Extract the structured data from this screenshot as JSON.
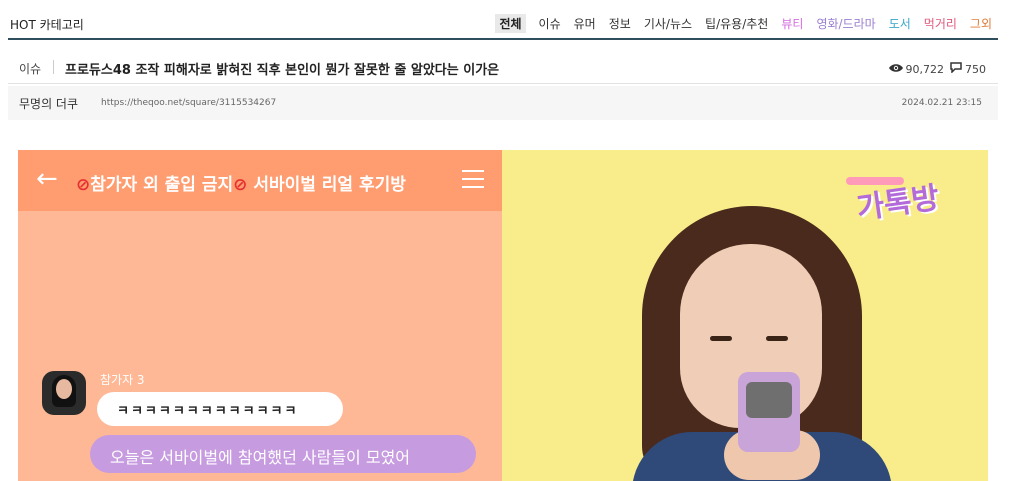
{
  "category_bar": {
    "label": "HOT 카테고리",
    "categories": [
      {
        "label": "전체",
        "color": "#222222",
        "active": true
      },
      {
        "label": "이슈",
        "color": "#333333"
      },
      {
        "label": "유머",
        "color": "#333333"
      },
      {
        "label": "정보",
        "color": "#333333"
      },
      {
        "label": "기사/뉴스",
        "color": "#333333"
      },
      {
        "label": "팁/유용/추천",
        "color": "#333333"
      },
      {
        "label": "뷰티",
        "color": "#d56ce0"
      },
      {
        "label": "영화/드라마",
        "color": "#9b7fd1"
      },
      {
        "label": "도서",
        "color": "#3aa6c8"
      },
      {
        "label": "먹거리",
        "color": "#e0577c"
      },
      {
        "label": "그외",
        "color": "#e07b3a"
      }
    ]
  },
  "post": {
    "tag": "이슈",
    "title": "프로듀스48 조작 피해자로 밝혀진 직후 본인이 뭔가 잘못한 줄 알았다는 이가은",
    "views": "90,722",
    "comments": "750",
    "author": "무명의 더쿠",
    "url": "https://theqoo.net/square/3115534267",
    "date": "2024.02.21 23:15"
  },
  "content_image": {
    "chat_title_text": "참가자 외 출입 금지",
    "chat_title_suffix": "서바이벌 리얼 후기방",
    "sender": "참가자 3",
    "message1": "ㅋㅋㅋㅋㅋㅋㅋㅋㅋㅋㅋㅋㅋ",
    "message2": "오늘은 서바이벌에 참여했던 사람들이 모였어",
    "logo": "가톡방"
  }
}
